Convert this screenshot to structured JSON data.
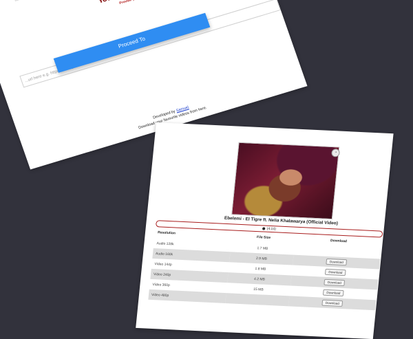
{
  "form": {
    "title": "Youtube Downloader",
    "subtitle": "Provide your link below",
    "url_placeholder": "...url here e.g. https://www.youtube.com",
    "proceed_label": "Proceed To",
    "developer_prefix": "Developed by",
    "developer_name": "Samuel",
    "tagline": "Download your favourite videos from here."
  },
  "result": {
    "video_title": "Ebelemi - El Tigre ft. Nelia Khalawarya (Official Video)",
    "duration": "(4:14)",
    "columns": [
      "Resolution",
      "File Size",
      "Download"
    ],
    "rows": [
      {
        "resolution": "Audio 128k",
        "size": "1.7 MB",
        "download": ""
      },
      {
        "resolution": "Audio 160k",
        "size": "2.9 MB",
        "download": "Download"
      },
      {
        "resolution": "Video 144p",
        "size": "1.8 MB",
        "download": "Download"
      },
      {
        "resolution": "Video 240p",
        "size": "4.2 MB",
        "download": "Download"
      },
      {
        "resolution": "Video 360p",
        "size": "15 MB",
        "download": "Download"
      },
      {
        "resolution": "Video 480p",
        "size": "",
        "download": "Download"
      }
    ]
  },
  "colors": {
    "background": "#32323c",
    "accent_button": "#2f8df2",
    "title_red": "#8a1a1a",
    "pill_border": "#a81c1c"
  }
}
